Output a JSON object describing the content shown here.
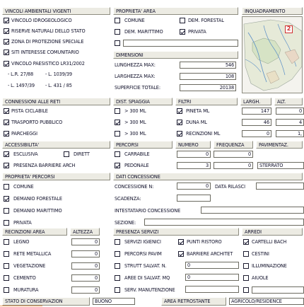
{
  "vincoli": {
    "header": "VINCOLI AMBIENTALI VIGENTI",
    "items": [
      {
        "label": "VINCOLO IDROGEOLOGICO",
        "checked": true
      },
      {
        "label": "RISERVE NATURALI DELLO STATO",
        "checked": true
      },
      {
        "label": "ZONA DI PROTEZIONE SPECIALE",
        "checked": true
      },
      {
        "label": "SITI INTERESSE COMUNITARIO",
        "checked": true
      },
      {
        "label": "VINCOLO PAESISTICO LR31/2002",
        "checked": true
      }
    ],
    "laws": [
      "- L.R. 27/88",
      "- L. 1039/39",
      "- L. 1497/39",
      "- L. 431 / 85"
    ]
  },
  "proprieta_area": {
    "header": "PROPRIETA' AREA",
    "items": [
      {
        "label": "COMUNE",
        "checked": false
      },
      {
        "label": "DEM. FORESTAL",
        "checked": false
      },
      {
        "label": "DEM. MARITTIMO",
        "checked": false
      },
      {
        "label": "PRIVATA",
        "checked": true
      },
      {
        "label": "",
        "checked": false
      }
    ]
  },
  "inquadramento": {
    "header": "INQUADRAMENTO",
    "marker": "2"
  },
  "dimensioni": {
    "header": "DIMENSIONI",
    "rows": [
      {
        "label": "LUNGHEZZA MAX:",
        "value": "546"
      },
      {
        "label": "LARGHEZZA MAX:",
        "value": "108"
      },
      {
        "label": "SUPERFICIE TOTALE:",
        "value": "20138"
      }
    ]
  },
  "connessioni": {
    "header": "CONNESSIONI ALLE RETI",
    "items": [
      {
        "label": "PISTA CICLABILE",
        "checked": true
      },
      {
        "label": "TRASPORTO PUBBLICO",
        "checked": true
      },
      {
        "label": "PARCHEGGI",
        "checked": true
      }
    ]
  },
  "dist_spiaggia": {
    "header": "DIST. SPIAGGIA",
    "items": [
      {
        "label": "> 300 ML",
        "checked": false
      },
      {
        "label": "> 300 ML",
        "checked": true
      },
      {
        "label": "> 300 ML",
        "checked": false
      }
    ]
  },
  "filtri": {
    "header": "FILTRI",
    "col_largh": "LARGH.",
    "col_alt": "ALT.",
    "items": [
      {
        "label": "PINETA ML",
        "checked": true,
        "largh": "147",
        "alt": "0"
      },
      {
        "label": "DUNA ML",
        "checked": true,
        "largh": "46",
        "alt": "4"
      },
      {
        "label": "RECINZIONI ML",
        "checked": true,
        "largh": "0",
        "alt": "1,"
      }
    ]
  },
  "accessibilita": {
    "header": "ACCESSIBILITA'",
    "esclusiva": {
      "label": "ESCLUSIVA",
      "checked": true
    },
    "diretto": {
      "label": "DIRETT",
      "checked": false
    },
    "barriere": {
      "label": "PRESENZA BARRIERE ARCH",
      "checked": true
    }
  },
  "percorsi": {
    "header": "PERCORSI",
    "col_numero": "NUMERO",
    "col_frequenza": "FREQUENZA",
    "items": [
      {
        "label": "CARRABILE",
        "checked": false,
        "numero": "0",
        "frequenza": "0"
      },
      {
        "label": "PEDONALE",
        "checked": true,
        "numero": "3",
        "frequenza": "0"
      }
    ]
  },
  "pavimentaz": {
    "header": "PAVIMENTAZ.",
    "value": "STERRATO"
  },
  "proprieta_percorsi": {
    "header": "PROPRIETA' PERCORSI",
    "items": [
      {
        "label": "COMUNE",
        "checked": false
      },
      {
        "label": "DEMANIO FORESTALE",
        "checked": true
      },
      {
        "label": "DEMANIO MARITTIMO",
        "checked": false
      },
      {
        "label": "PRIVATA",
        "checked": false
      }
    ]
  },
  "dati_concessione": {
    "header": "DATI CONCESSIONE",
    "concessione_label": "CONCESSIONE N:",
    "concessione_value": "0",
    "data_rilascio_label": "DATA RILASCI",
    "scadenza_label": "SCADENZA:",
    "intestatario_label": "INTESTATARIO CONCESSIONE",
    "sezione_label": "SEZIONE:"
  },
  "recinzioni": {
    "header": "RECINZIONI AREA",
    "col_altezza": "ALTEZZA",
    "items": [
      {
        "label": "LEGNO",
        "checked": false,
        "value": "0"
      },
      {
        "label": "RETE METALLICA",
        "checked": false,
        "value": "0"
      },
      {
        "label": "VEGETAZIONE",
        "checked": false,
        "value": "0"
      },
      {
        "label": "CEMENTO",
        "checked": false,
        "value": "0"
      },
      {
        "label": "MURATURA",
        "checked": false,
        "value": "0"
      }
    ]
  },
  "servizi": {
    "header": "PRESENZA SERVIZI",
    "left": [
      {
        "label": "SERVIZI IGIENICI",
        "checked": false
      },
      {
        "label": "PERCORSI PAVIM",
        "checked": false
      },
      {
        "label": "STRUTT SALVAT. N.",
        "checked": false,
        "value": "0"
      },
      {
        "label": "AREE DI SALVAT. MQ",
        "checked": false,
        "value": "0"
      },
      {
        "label": "SERV. MANUTENZIONE",
        "checked": false,
        "value": ""
      }
    ],
    "right": [
      {
        "label": "PUNTI RISTORO",
        "checked": true
      },
      {
        "label": "BARRIERE ARCHITET",
        "checked": true
      }
    ]
  },
  "arredi": {
    "header": "ARREDI",
    "items": [
      {
        "label": "CARTELLI BACH",
        "checked": true
      },
      {
        "label": "CESTINI",
        "checked": false
      },
      {
        "label": "ILLUMINAZIONE",
        "checked": false
      },
      {
        "label": "AIUOLE",
        "checked": false
      },
      {
        "label": "",
        "checked": false
      }
    ]
  },
  "footer": {
    "stato_label": "STATO DI CONSERVAZION",
    "stato_value": "BUONO",
    "area_label": "AREA RETROSTANTE",
    "area_value": "AGRICOLO/RESIDENCE"
  }
}
